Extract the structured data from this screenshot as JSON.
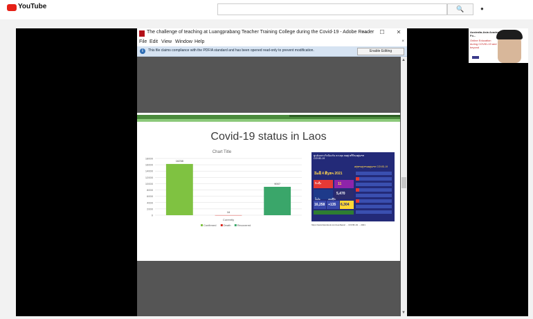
{
  "youtube": {
    "logo_text": "YouTube"
  },
  "webcam": {
    "slide_title": "Australia-Asia Academic Fo...",
    "slide_red": "Online Education during COVID-19 and beyond"
  },
  "reader": {
    "window_title": "The challenge of teaching at Luangprabang Teacher Training College during the Covid-19 - Adobe Reader",
    "controls": {
      "minimize": "—",
      "maximize": "☐",
      "close": "✕"
    },
    "menu": [
      "File",
      "Edit",
      "View",
      "Window",
      "Help"
    ],
    "menu_close": "×",
    "info_message": "This file claims compliance with the PDF/A standard and has been opened read-only to prevent modification.",
    "enable_editing": "Enable Editing"
  },
  "slide": {
    "heading": "Covid-19 status in Laos",
    "panel": {
      "header": "ศูนย์เฉพาะกิจป้องกัน ควบคุม ແລະ ແກ້ໄຂ ພະຍາດ COVID-19",
      "subheader": "ສະຖານະການພະຍາດ COVID-19",
      "date": "ວັນທີ 4 ສິງຫາ 2021",
      "numbers": [
        "5,470",
        "16,258",
        "+135",
        "6,304",
        "11"
      ],
      "labels": [
        "ຕິດເຊື້ອ",
        "ປິ່ນປົວ",
        "ເສຍຊີວິດ"
      ]
    },
    "caption": "https://www.facebook.com/LaoNews/ ... COVID-19 ... 2021"
  },
  "chart_data": {
    "type": "bar",
    "title": "Chart Title",
    "categories": [
      "Currently"
    ],
    "series": [
      {
        "name": "Confirmed",
        "values": [
          16258
        ],
        "color": "#7fc241"
      },
      {
        "name": "Death",
        "values": [
          16
        ],
        "color": "#d9251d"
      },
      {
        "name": "Recovered",
        "values": [
          9007
        ],
        "color": "#3aa66a"
      }
    ],
    "data_labels": [
      "16258",
      "16",
      "9007"
    ],
    "y_ticks": [
      "0",
      "2000",
      "4000",
      "6000",
      "8000",
      "10000",
      "12000",
      "14000",
      "16000",
      "18000"
    ],
    "ylim": [
      0,
      18000
    ],
    "xlabel": "Currently",
    "legend": [
      "Confirmed",
      "Death",
      "Recovered"
    ],
    "legend_position": "bottom",
    "grid": true
  }
}
